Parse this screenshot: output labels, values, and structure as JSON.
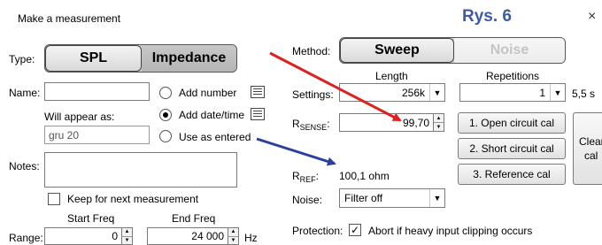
{
  "window": {
    "title": "Make a measurement",
    "close_label": "×"
  },
  "overlay": {
    "figure_label": "Rys. 6",
    "figure_color": "#3c5aa6",
    "arrow_red": "#e02020",
    "arrow_blue": "#2a3fa0"
  },
  "type_row": {
    "label": "Type:",
    "options": [
      "SPL",
      "Impedance"
    ],
    "selected": "Impedance"
  },
  "name_row": {
    "label": "Name:",
    "value": ""
  },
  "appear": {
    "label": "Will appear as:",
    "value": "gru 20"
  },
  "naming_options": [
    {
      "label": "Add number",
      "checked": false
    },
    {
      "label": "Add date/time",
      "checked": true
    },
    {
      "label": "Use as entered",
      "checked": false
    }
  ],
  "notes": {
    "label": "Notes:",
    "value": ""
  },
  "keep": {
    "label": "Keep for next measurement",
    "checked": false
  },
  "freq": {
    "start_label": "Start Freq",
    "end_label": "End Freq",
    "range_label": "Range:",
    "start_value": "0",
    "end_value": "24 000",
    "unit": "Hz"
  },
  "method": {
    "label": "Method:",
    "options": [
      "Sweep",
      "Noise"
    ],
    "selected": "Sweep"
  },
  "settings": {
    "label": "Settings:",
    "length_header": "Length",
    "length_value": "256k",
    "repetitions_header": "Repetitions",
    "repetitions_value": "1",
    "duration": "5,5 s"
  },
  "rsense": {
    "label_main": "R",
    "label_sub": "SENSE",
    "label_tail": ":",
    "value": "99,70"
  },
  "rref": {
    "label_main": "R",
    "label_sub": "REF",
    "label_tail": ":",
    "value": "100,1 ohm"
  },
  "noise": {
    "label": "Noise:",
    "value": "Filter off"
  },
  "cal_buttons": [
    "1. Open circuit cal",
    "2. Short circuit cal",
    "3. Reference cal"
  ],
  "clear_cal": {
    "line1": "Clear",
    "line2": "cal"
  },
  "protection": {
    "label": "Protection:",
    "checkbox_label": "Abort if heavy input clipping occurs",
    "checked": true
  }
}
